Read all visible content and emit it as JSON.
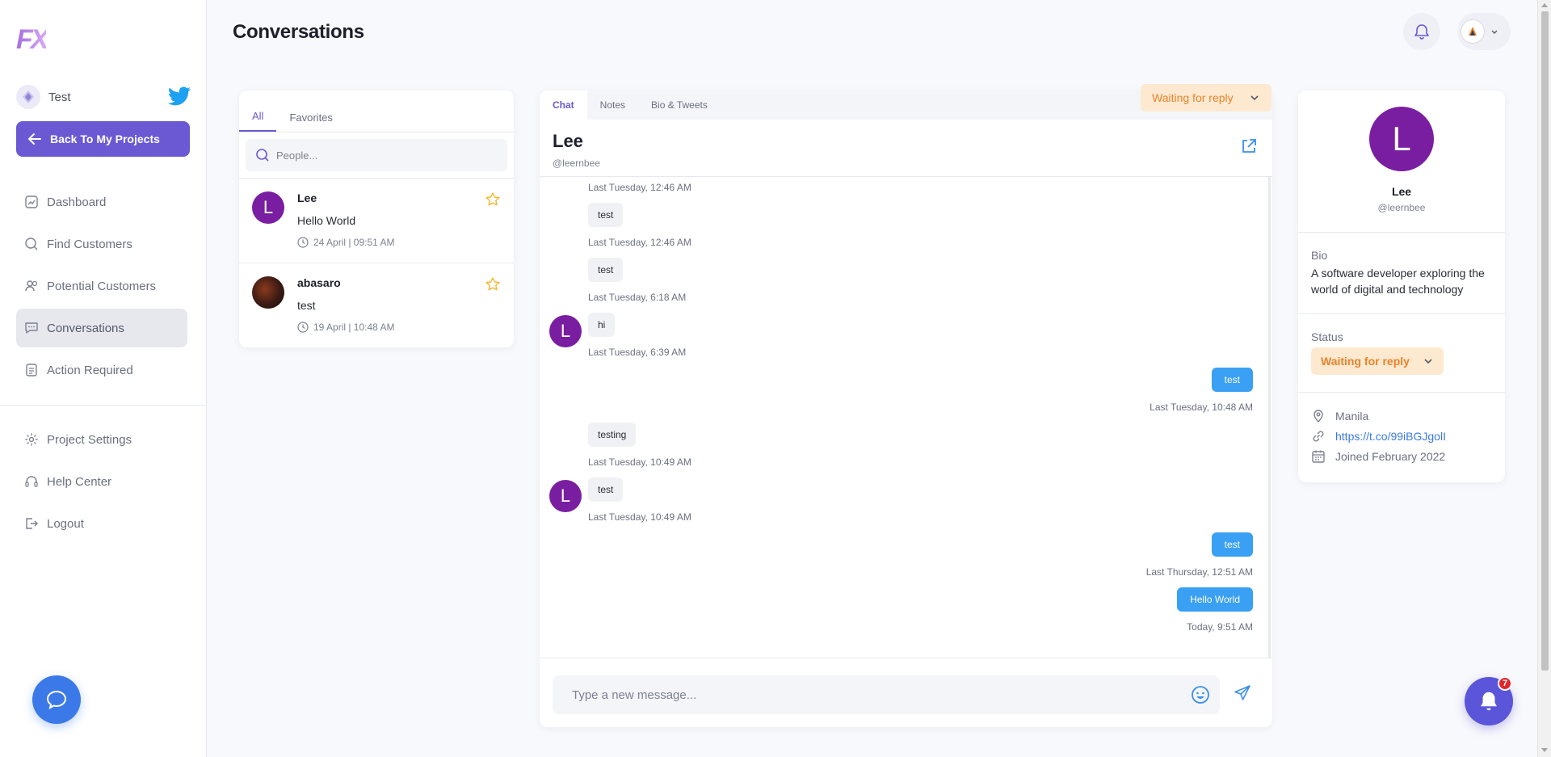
{
  "brand": {
    "logo_text": "FX",
    "accent": "#6a59d3"
  },
  "sidebar": {
    "project_name": "Test",
    "back_label": "Back To My Projects",
    "items": [
      {
        "label": "Dashboard",
        "icon": "dashboard-icon"
      },
      {
        "label": "Find Customers",
        "icon": "search-icon"
      },
      {
        "label": "Potential Customers",
        "icon": "users-icon"
      },
      {
        "label": "Conversations",
        "icon": "chat-icon",
        "active": true
      },
      {
        "label": "Action Required",
        "icon": "clipboard-icon"
      }
    ],
    "bottom_items": [
      {
        "label": "Project Settings",
        "icon": "gear-icon"
      },
      {
        "label": "Help Center",
        "icon": "headset-icon"
      },
      {
        "label": "Logout",
        "icon": "logout-icon"
      }
    ]
  },
  "header": {
    "title": "Conversations"
  },
  "conversation_list": {
    "tabs": [
      "All",
      "Favorites"
    ],
    "active_tab": "All",
    "search_placeholder": "People...",
    "items": [
      {
        "initial": "L",
        "name": "Lee",
        "preview": "Hello World",
        "time": "24 April | 09:51 AM"
      },
      {
        "initial": "",
        "name": "abasaro",
        "preview": "test",
        "time": "19 April | 10:48 AM"
      }
    ]
  },
  "chat": {
    "tabs": [
      "Chat",
      "Notes",
      "Bio & Tweets"
    ],
    "active_tab": "Chat",
    "status": "Waiting for reply",
    "contact_name": "Lee",
    "contact_handle": "@leernbee",
    "avatar_initial": "L",
    "messages": [
      {
        "dir": "in",
        "text": "",
        "time": "Last Tuesday, 12:46 AM"
      },
      {
        "dir": "in",
        "text": "test",
        "time": "Last Tuesday, 12:46 AM"
      },
      {
        "dir": "in",
        "text": "test",
        "time": "Last Tuesday, 6:18 AM"
      },
      {
        "dir": "in",
        "text": "hi",
        "time": "Last Tuesday, 6:39 AM"
      },
      {
        "dir": "out",
        "text": "test",
        "time": "Last Tuesday, 10:48 AM"
      },
      {
        "dir": "in",
        "text": "testing",
        "time": "Last Tuesday, 10:49 AM"
      },
      {
        "dir": "in",
        "text": "test",
        "time": "Last Tuesday, 10:49 AM"
      },
      {
        "dir": "out",
        "text": "test",
        "time": "Last Thursday, 12:51 AM"
      },
      {
        "dir": "out",
        "text": "Hello World",
        "time": "Today, 9:51 AM"
      }
    ],
    "composer_placeholder": "Type a new message..."
  },
  "profile": {
    "initial": "L",
    "name": "Lee",
    "handle": "@leernbee",
    "bio_label": "Bio",
    "bio": "A software developer exploring the world of digital and technology",
    "status_label": "Status",
    "status": "Waiting for reply",
    "location": "Manila",
    "link": "https://t.co/99iBGJgolI",
    "joined": "Joined February 2022"
  },
  "notifications": {
    "count": "7"
  },
  "colors": {
    "primary": "#6a59d3",
    "bubble_out": "#3aa0f3",
    "status_bg": "#fde9d0",
    "status_text": "#e8832b",
    "avatar": "#7a1ea1",
    "star": "#f5b52e"
  }
}
